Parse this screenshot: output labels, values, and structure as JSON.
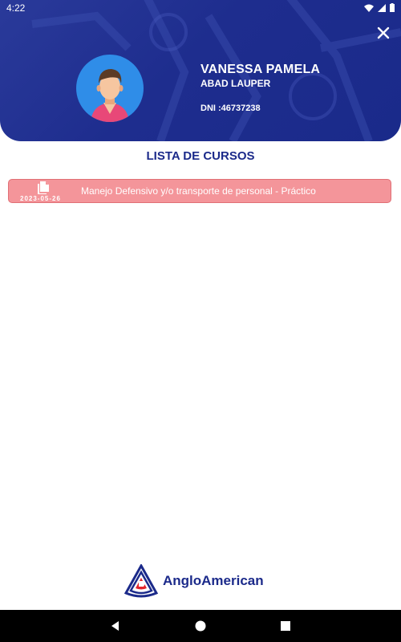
{
  "status_bar": {
    "time": "4:22"
  },
  "profile": {
    "first_name": "VANESSA PAMELA",
    "last_name": "ABAD LAUPER",
    "dni": "DNI :46737238"
  },
  "courses": {
    "title": "LISTA DE CURSOS",
    "items": [
      {
        "date": "2023-05-26",
        "name": "Manejo Defensivo y/o transporte de personal - Práctico"
      }
    ]
  },
  "brand": {
    "name": "AngloAmerican"
  },
  "colors": {
    "primary": "#1b2a8a",
    "course_bg": "#f4959a",
    "avatar_bg": "#2f8de8"
  }
}
